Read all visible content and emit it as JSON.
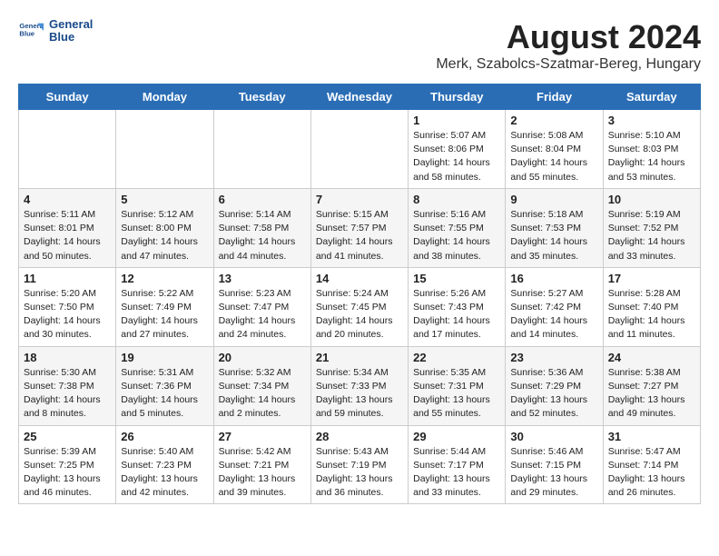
{
  "header": {
    "logo_line1": "General",
    "logo_line2": "Blue",
    "month_title": "August 2024",
    "location": "Merk, Szabolcs-Szatmar-Bereg, Hungary"
  },
  "days_of_week": [
    "Sunday",
    "Monday",
    "Tuesday",
    "Wednesday",
    "Thursday",
    "Friday",
    "Saturday"
  ],
  "weeks": [
    [
      {
        "day": "",
        "info": ""
      },
      {
        "day": "",
        "info": ""
      },
      {
        "day": "",
        "info": ""
      },
      {
        "day": "",
        "info": ""
      },
      {
        "day": "1",
        "info": "Sunrise: 5:07 AM\nSunset: 8:06 PM\nDaylight: 14 hours\nand 58 minutes."
      },
      {
        "day": "2",
        "info": "Sunrise: 5:08 AM\nSunset: 8:04 PM\nDaylight: 14 hours\nand 55 minutes."
      },
      {
        "day": "3",
        "info": "Sunrise: 5:10 AM\nSunset: 8:03 PM\nDaylight: 14 hours\nand 53 minutes."
      }
    ],
    [
      {
        "day": "4",
        "info": "Sunrise: 5:11 AM\nSunset: 8:01 PM\nDaylight: 14 hours\nand 50 minutes."
      },
      {
        "day": "5",
        "info": "Sunrise: 5:12 AM\nSunset: 8:00 PM\nDaylight: 14 hours\nand 47 minutes."
      },
      {
        "day": "6",
        "info": "Sunrise: 5:14 AM\nSunset: 7:58 PM\nDaylight: 14 hours\nand 44 minutes."
      },
      {
        "day": "7",
        "info": "Sunrise: 5:15 AM\nSunset: 7:57 PM\nDaylight: 14 hours\nand 41 minutes."
      },
      {
        "day": "8",
        "info": "Sunrise: 5:16 AM\nSunset: 7:55 PM\nDaylight: 14 hours\nand 38 minutes."
      },
      {
        "day": "9",
        "info": "Sunrise: 5:18 AM\nSunset: 7:53 PM\nDaylight: 14 hours\nand 35 minutes."
      },
      {
        "day": "10",
        "info": "Sunrise: 5:19 AM\nSunset: 7:52 PM\nDaylight: 14 hours\nand 33 minutes."
      }
    ],
    [
      {
        "day": "11",
        "info": "Sunrise: 5:20 AM\nSunset: 7:50 PM\nDaylight: 14 hours\nand 30 minutes."
      },
      {
        "day": "12",
        "info": "Sunrise: 5:22 AM\nSunset: 7:49 PM\nDaylight: 14 hours\nand 27 minutes."
      },
      {
        "day": "13",
        "info": "Sunrise: 5:23 AM\nSunset: 7:47 PM\nDaylight: 14 hours\nand 24 minutes."
      },
      {
        "day": "14",
        "info": "Sunrise: 5:24 AM\nSunset: 7:45 PM\nDaylight: 14 hours\nand 20 minutes."
      },
      {
        "day": "15",
        "info": "Sunrise: 5:26 AM\nSunset: 7:43 PM\nDaylight: 14 hours\nand 17 minutes."
      },
      {
        "day": "16",
        "info": "Sunrise: 5:27 AM\nSunset: 7:42 PM\nDaylight: 14 hours\nand 14 minutes."
      },
      {
        "day": "17",
        "info": "Sunrise: 5:28 AM\nSunset: 7:40 PM\nDaylight: 14 hours\nand 11 minutes."
      }
    ],
    [
      {
        "day": "18",
        "info": "Sunrise: 5:30 AM\nSunset: 7:38 PM\nDaylight: 14 hours\nand 8 minutes."
      },
      {
        "day": "19",
        "info": "Sunrise: 5:31 AM\nSunset: 7:36 PM\nDaylight: 14 hours\nand 5 minutes."
      },
      {
        "day": "20",
        "info": "Sunrise: 5:32 AM\nSunset: 7:34 PM\nDaylight: 14 hours\nand 2 minutes."
      },
      {
        "day": "21",
        "info": "Sunrise: 5:34 AM\nSunset: 7:33 PM\nDaylight: 13 hours\nand 59 minutes."
      },
      {
        "day": "22",
        "info": "Sunrise: 5:35 AM\nSunset: 7:31 PM\nDaylight: 13 hours\nand 55 minutes."
      },
      {
        "day": "23",
        "info": "Sunrise: 5:36 AM\nSunset: 7:29 PM\nDaylight: 13 hours\nand 52 minutes."
      },
      {
        "day": "24",
        "info": "Sunrise: 5:38 AM\nSunset: 7:27 PM\nDaylight: 13 hours\nand 49 minutes."
      }
    ],
    [
      {
        "day": "25",
        "info": "Sunrise: 5:39 AM\nSunset: 7:25 PM\nDaylight: 13 hours\nand 46 minutes."
      },
      {
        "day": "26",
        "info": "Sunrise: 5:40 AM\nSunset: 7:23 PM\nDaylight: 13 hours\nand 42 minutes."
      },
      {
        "day": "27",
        "info": "Sunrise: 5:42 AM\nSunset: 7:21 PM\nDaylight: 13 hours\nand 39 minutes."
      },
      {
        "day": "28",
        "info": "Sunrise: 5:43 AM\nSunset: 7:19 PM\nDaylight: 13 hours\nand 36 minutes."
      },
      {
        "day": "29",
        "info": "Sunrise: 5:44 AM\nSunset: 7:17 PM\nDaylight: 13 hours\nand 33 minutes."
      },
      {
        "day": "30",
        "info": "Sunrise: 5:46 AM\nSunset: 7:15 PM\nDaylight: 13 hours\nand 29 minutes."
      },
      {
        "day": "31",
        "info": "Sunrise: 5:47 AM\nSunset: 7:14 PM\nDaylight: 13 hours\nand 26 minutes."
      }
    ]
  ]
}
